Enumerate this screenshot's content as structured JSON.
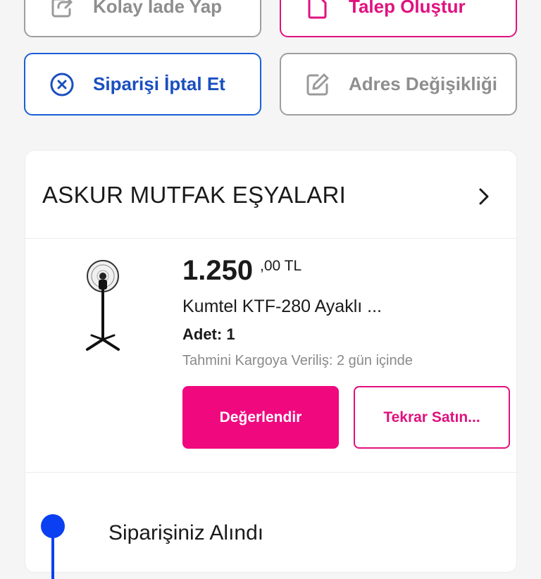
{
  "actions": {
    "easy_return": {
      "label": "Kolay İade Yap",
      "icon": "return-icon"
    },
    "create_request": {
      "label": "Talep Oluştur",
      "icon": "document-icon"
    },
    "cancel_order": {
      "label": "Siparişi İptal Et",
      "icon": "cancel-circle-icon"
    },
    "address_change": {
      "label": "Adres Değişikliği",
      "icon": "edit-icon"
    }
  },
  "seller": {
    "name": "ASKUR MUTFAK EŞYALARI"
  },
  "product": {
    "price_main": "1.250",
    "price_decimal": ",00 TL",
    "name": "Kumtel KTF-280 Ayaklı ...",
    "quantity": "Adet: 1",
    "shipping_estimate": "Tahmini Kargoya Veriliş: 2 gün içinde",
    "image": "standing-fan-image"
  },
  "buttons": {
    "rate": "Değerlendir",
    "rebuy": "Tekrar Satın..."
  },
  "status": {
    "text": "Siparişiniz Alındı"
  },
  "colors": {
    "pink": "#e0117f",
    "pink_fill": "#f0087f",
    "blue": "#1a5fd6",
    "timeline_blue": "#0a3ff2",
    "gray_border": "#9e9e9e"
  }
}
